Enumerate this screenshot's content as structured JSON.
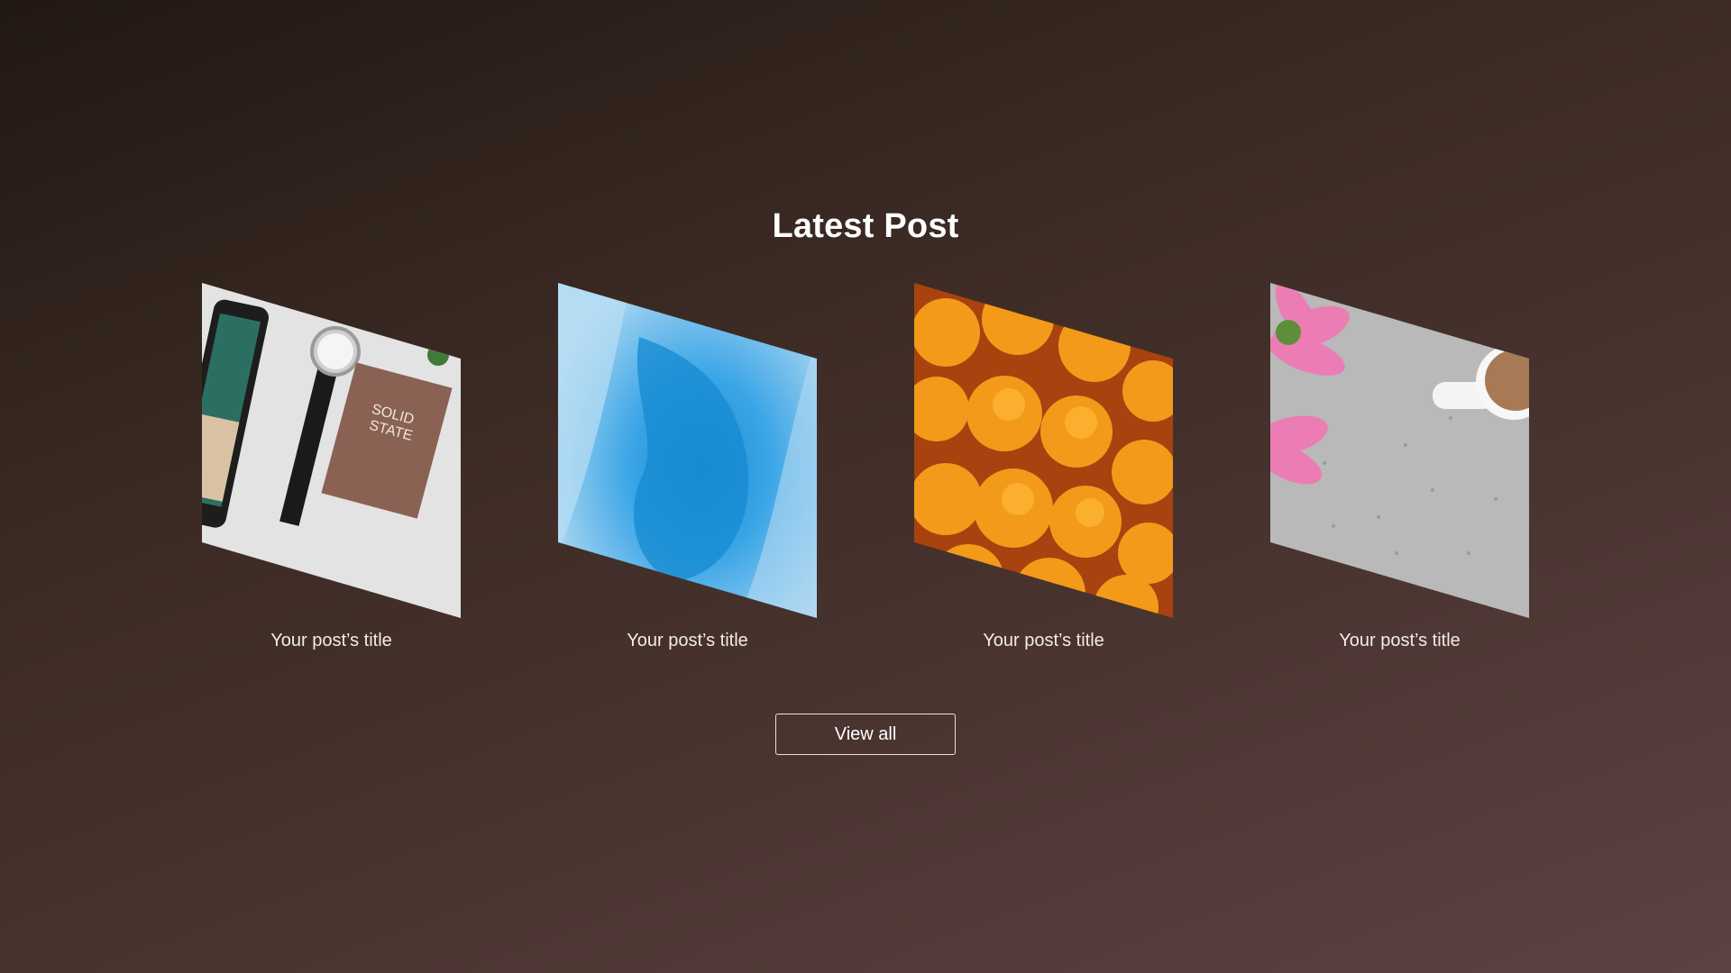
{
  "section": {
    "heading": "Latest Post",
    "view_all_label": "View all"
  },
  "posts": [
    {
      "title": "Your post’s title",
      "image": "desk-flatlay-phone-watch-book"
    },
    {
      "title": "Your post’s title",
      "image": "blue-ice-texture"
    },
    {
      "title": "Your post’s title",
      "image": "oranges-pile"
    },
    {
      "title": "Your post’s title",
      "image": "pink-flowers-coffee-cup"
    }
  ],
  "colors": {
    "background_start": "#221813",
    "background_end": "#5c4342",
    "text": "#ffffff",
    "button_border": "#ecdfdb"
  }
}
